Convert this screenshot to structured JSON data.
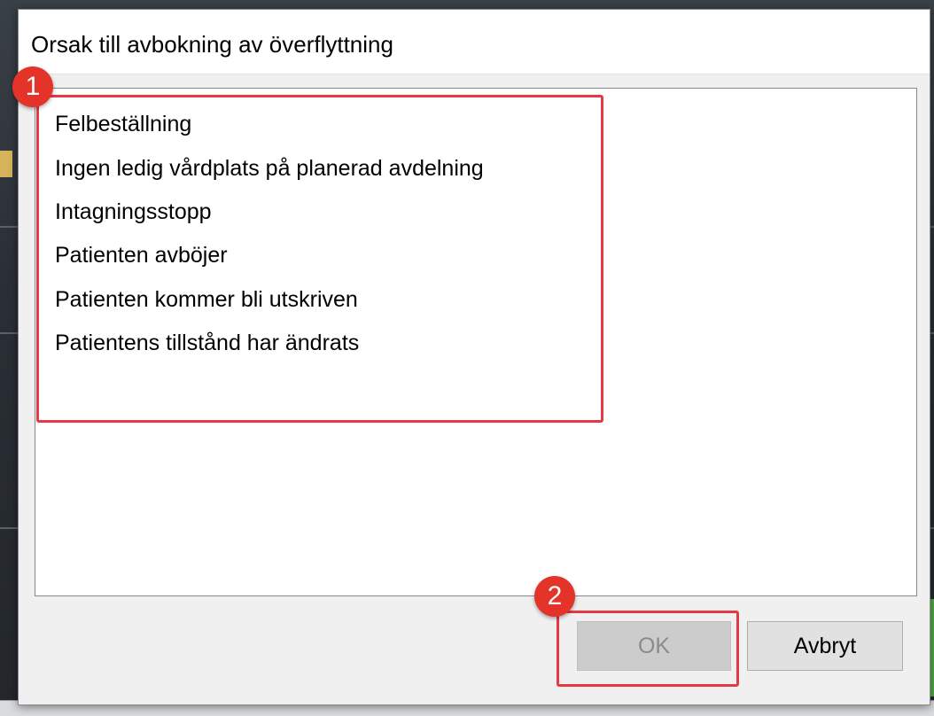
{
  "dialog": {
    "title": "Orsak till avbokning av överflyttning"
  },
  "reasons": [
    "Felbeställning",
    "Ingen ledig vårdplats på planerad avdelning",
    "Intagningsstopp",
    "Patienten avböjer",
    "Patienten kommer bli utskriven",
    "Patientens tillstånd har ändrats"
  ],
  "buttons": {
    "ok_label": "OK",
    "ok_enabled": false,
    "cancel_label": "Avbryt"
  },
  "annotations": {
    "badge_1": "1",
    "badge_2": "2",
    "color": "#e63946"
  }
}
